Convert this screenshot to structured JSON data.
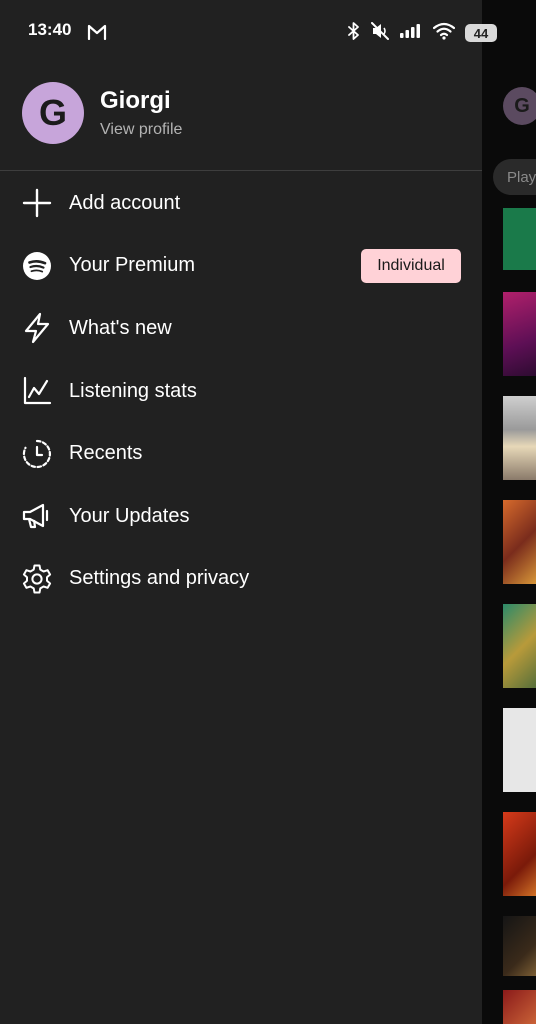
{
  "status_bar": {
    "time": "13:40",
    "battery": "44",
    "icons": [
      "gmail-icon",
      "bluetooth-icon",
      "mute-icon",
      "signal-icon",
      "wifi-icon",
      "battery-icon"
    ]
  },
  "profile": {
    "initial": "G",
    "name": "Giorgi",
    "link": "View profile"
  },
  "menu": {
    "items": [
      {
        "label": "Add account",
        "icon": "plus-icon"
      },
      {
        "label": "Your Premium",
        "icon": "spotify-icon",
        "badge": "Individual"
      },
      {
        "label": "What's new",
        "icon": "lightning-icon"
      },
      {
        "label": "Listening stats",
        "icon": "stats-icon"
      },
      {
        "label": "Recents",
        "icon": "clock-icon"
      },
      {
        "label": "Your Updates",
        "icon": "megaphone-icon"
      },
      {
        "label": "Settings and privacy",
        "icon": "gear-icon"
      }
    ]
  },
  "background": {
    "avatar_initial": "G",
    "chip_label": "Play"
  },
  "colors": {
    "drawer": "#212121",
    "avatar": "#c7a5da",
    "badge": "#ffd2d7",
    "muted_text": "#b3b3b3"
  }
}
